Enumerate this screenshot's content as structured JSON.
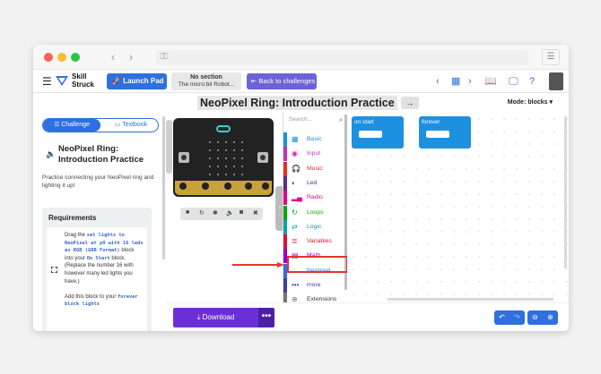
{
  "logo": {
    "line1": "Skill",
    "line2": "Struck"
  },
  "topbar": {
    "launch_pad": "Launch Pad",
    "section_title": "No section",
    "section_sub": "The micro:bit Robot...",
    "back_label": "Back to challenges"
  },
  "page": {
    "title": "NeoPixel Ring: Introduction Practice",
    "mode": "Mode: blocks"
  },
  "tabs": {
    "challenge": "Challenge",
    "textbook": "Textbook"
  },
  "lesson": {
    "title": "NeoPixel Ring: Introduction Practice",
    "description": "Practice connecting your NeoPixel ring and lighting it up!"
  },
  "requirements": {
    "title": "Requirements",
    "t1": "Drag the ",
    "code1": "set lights to NeoPixel at p0 with 16 leds as RGB (GRB Format)",
    "t2": " block into your ",
    "code2": "On Start",
    "t3": " block. (Replace the number 16 with however many led lights you have.)",
    "t4": "Add this block to your ",
    "code3": "forever block lights"
  },
  "toolbox": {
    "search_placeholder": "Search...",
    "categories": [
      {
        "label": "Basic",
        "color": "#1e90e0",
        "icon": "grid-icon"
      },
      {
        "label": "Input",
        "color": "#c42fb8",
        "icon": "target-icon"
      },
      {
        "label": "Music",
        "color": "#e63022",
        "icon": "headphones-icon"
      },
      {
        "label": "Led",
        "color": "#5c2d91",
        "icon": "toggle-icon"
      },
      {
        "label": "Radio",
        "color": "#e3008c",
        "icon": "signal-icon"
      },
      {
        "label": "Loops",
        "color": "#00aa00",
        "icon": "refresh-icon"
      },
      {
        "label": "Logic",
        "color": "#00a4a6",
        "icon": "shuffle-icon"
      },
      {
        "label": "Variables",
        "color": "#dc143c",
        "icon": "list-icon"
      },
      {
        "label": "Math",
        "color": "#9400d3",
        "icon": "calculator-icon"
      },
      {
        "label": "Neopixel",
        "color": "#2f6fe0",
        "icon": "spinner-icon"
      },
      {
        "label": "more",
        "color": "#3e3e9c",
        "icon": "dots-icon"
      },
      {
        "label": "Extensions",
        "color": "#777777",
        "icon": "plus-icon"
      }
    ]
  },
  "workspace": {
    "on_start": "on start",
    "forever": "forever"
  },
  "bottombar": {
    "download": "Download"
  }
}
